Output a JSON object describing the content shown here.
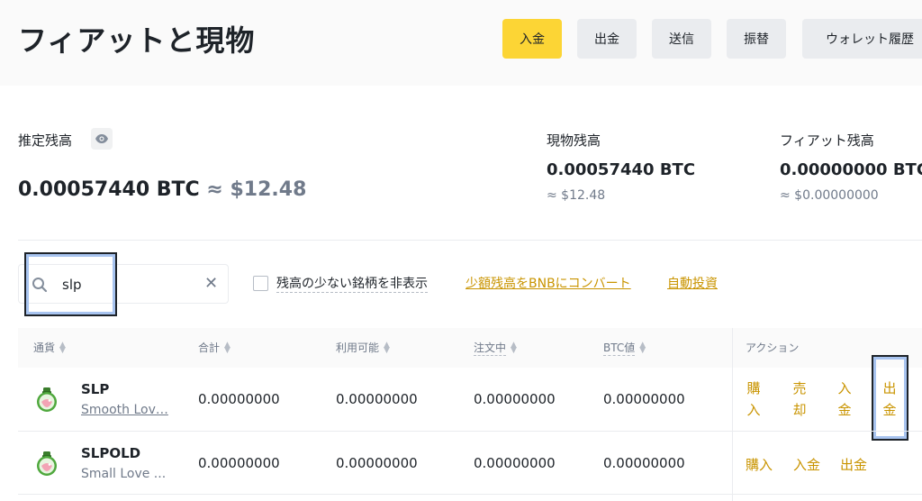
{
  "page": {
    "title": "フィアットと現物"
  },
  "header_buttons": [
    {
      "label": "入金"
    },
    {
      "label": "出金"
    },
    {
      "label": "送信"
    },
    {
      "label": "振替"
    },
    {
      "label": "ウォレット履歴"
    }
  ],
  "balances": {
    "estimated": {
      "label": "推定残高",
      "btc": "0.00057440 BTC",
      "usd": "≈ $12.48"
    },
    "spot": {
      "label": "現物残高",
      "btc": "0.00057440 BTC",
      "usd": "≈ $12.48"
    },
    "fiat": {
      "label": "フィアット残高",
      "btc": "0.00000000 BTC",
      "usd": "≈ $0.00000000"
    }
  },
  "filters": {
    "search_value": "slp",
    "hide_small_label": "残高の少ない銘柄を非表示",
    "convert_link": "少額残高をBNBにコンバート",
    "auto_invest_link": "自動投資"
  },
  "table": {
    "columns": [
      "通貨",
      "合計",
      "利用可能",
      "注文中",
      "BTC値",
      "アクション"
    ],
    "rows": [
      {
        "symbol": "SLP",
        "name": "Smooth Lov…",
        "total": "0.00000000",
        "available": "0.00000000",
        "in_order": "0.00000000",
        "btc_value": "0.00000000",
        "actions": [
          "購入",
          "売却",
          "入金",
          "出金"
        ]
      },
      {
        "symbol": "SLPOLD",
        "name": "Small Love ...",
        "total": "0.00000000",
        "available": "0.00000000",
        "in_order": "0.00000000",
        "btc_value": "0.00000000",
        "actions": [
          "購入",
          "入金",
          "出金"
        ]
      }
    ]
  },
  "colors": {
    "primary_button": "#fcd535",
    "secondary_button": "#eaecef",
    "link": "#c99400",
    "text_secondary": "#707a8a",
    "annotation": "#a8c4f0"
  }
}
